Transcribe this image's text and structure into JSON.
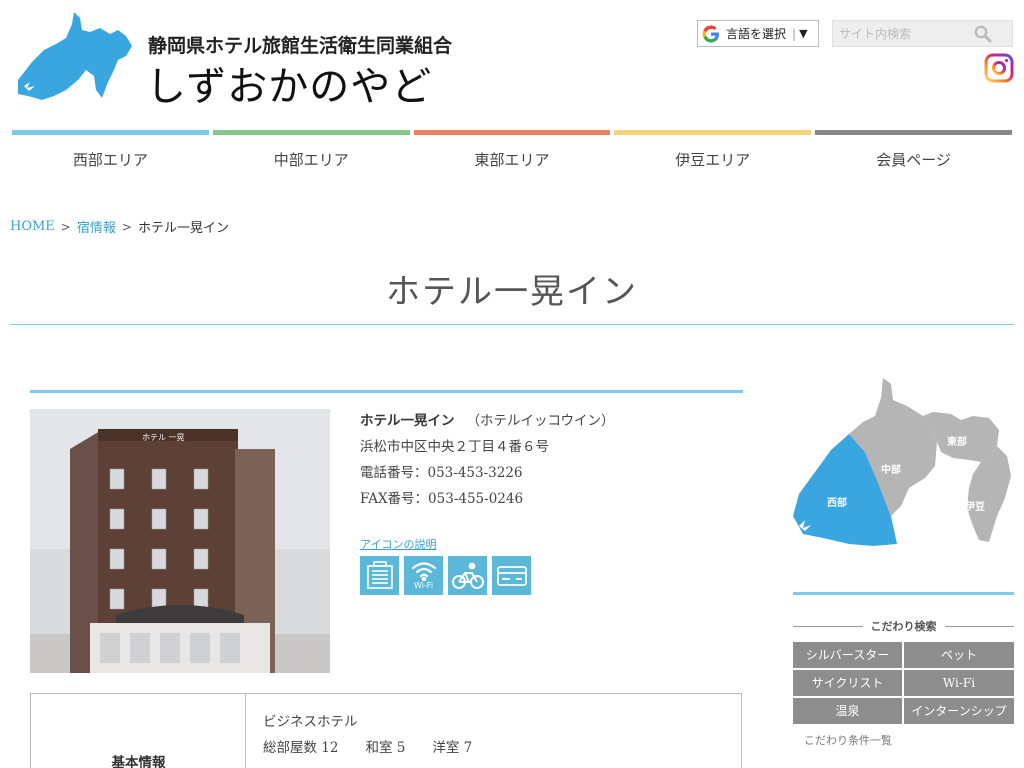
{
  "header": {
    "org_name": "静岡県ホテル旅館生活衛生同業組合",
    "site_name": "しずおかのやど",
    "language_select": "言語を選択",
    "search_placeholder": "サイト内検索"
  },
  "nav": {
    "items": [
      {
        "label": "西部エリア",
        "color": "#7ecbe8"
      },
      {
        "label": "中部エリア",
        "color": "#86c78e"
      },
      {
        "label": "東部エリア",
        "color": "#e9835e"
      },
      {
        "label": "伊豆エリア",
        "color": "#f6d27a"
      },
      {
        "label": "会員ページ",
        "color": "#888888"
      }
    ]
  },
  "breadcrumb": {
    "home": "HOME",
    "section": "宿情報",
    "current": "ホテル一晃イン"
  },
  "page": {
    "title": "ホテル一晃イン"
  },
  "hotel": {
    "name": "ホテル一晃イン",
    "kana": "（ホテルイッコウイン）",
    "address": "浜松市中区中央２丁目４番６号",
    "phone": "電話番号：053-453-3226",
    "fax": "FAX番号：053-455-0246",
    "icon_help": "アイコンの説明",
    "sign_text": "ホテル 一晃",
    "features": [
      "building-icon",
      "wifi-icon",
      "cycling-icon",
      "credit-card-icon"
    ],
    "wifi_label": "Wi-Fi"
  },
  "info_table": {
    "label": "基本情報",
    "type": "ビジネスホテル",
    "rooms": "総部屋数 12　　和室 5　　洋室 7"
  },
  "sidebar": {
    "map_labels": {
      "west": "西部",
      "central": "中部",
      "east": "東部",
      "izu": "伊豆"
    },
    "search_heading": "こだわり検索",
    "buttons": [
      "シルバースター",
      "ペット",
      "サイクリスト",
      "Wi-Fi",
      "温泉",
      "インターンシップ"
    ],
    "more_link": "こだわり条件一覧"
  },
  "colors": {
    "accent": "#7ecbe8",
    "link": "#3aa1d0",
    "west_area": "#3aa6e0",
    "gray_area": "#b5b5b5"
  }
}
